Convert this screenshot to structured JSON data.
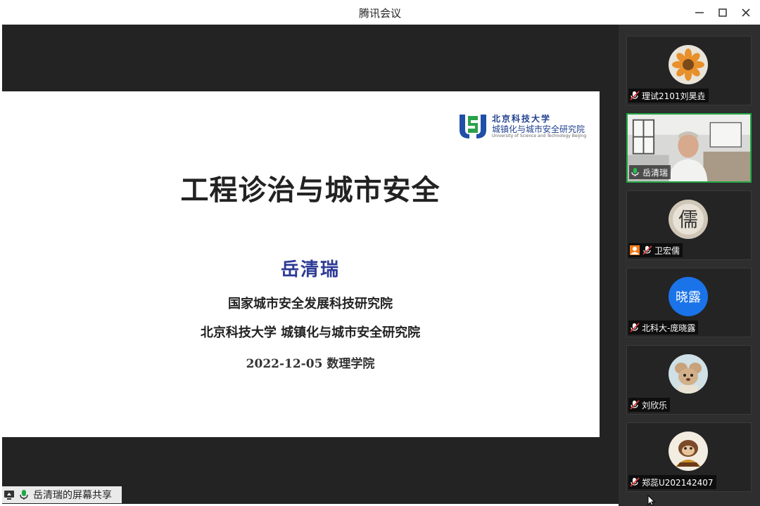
{
  "window": {
    "title": "腾讯会议"
  },
  "slide": {
    "logo_line1": "北京科技大学",
    "logo_line2": "城镇化与城市安全研究院",
    "logo_line3": "University of Science and Technology Beijing",
    "title": "工程诊治与城市安全",
    "author": "岳清瑞",
    "org1": "国家城市安全发展科技研究院",
    "org2": "北京科技大学  城镇化与城市安全研究院",
    "date": "2022-12-05  数理学院"
  },
  "share_status": {
    "label": "岳清瑞的屏幕共享"
  },
  "participants": [
    {
      "name": "理试2101刘昊垚",
      "mic": "muted",
      "avatar": "sunflower-photo"
    },
    {
      "name": "岳清瑞",
      "mic": "active",
      "avatar": "camera-video",
      "speaking": true
    },
    {
      "name": "卫宏儒",
      "mic": "muted",
      "avatar": "calligraphy-photo",
      "host": true,
      "avatar_char": "儒"
    },
    {
      "name": "北科大-庞晓露",
      "mic": "muted",
      "avatar": "text-avatar",
      "avatar_text": "晓露",
      "avatar_color": "#1a73e8"
    },
    {
      "name": "刘欣乐",
      "mic": "muted",
      "avatar": "cartoon-photo"
    },
    {
      "name": "郑蕊U202142407",
      "mic": "muted",
      "avatar": "cartoon-dog-photo"
    }
  ],
  "colors": {
    "stage_bg": "#232323",
    "sidebar_bg": "#2e2e2e",
    "speaking_border": "#22a846",
    "mic_muted": "#e03a3a",
    "author_blue": "#2c3a96"
  }
}
